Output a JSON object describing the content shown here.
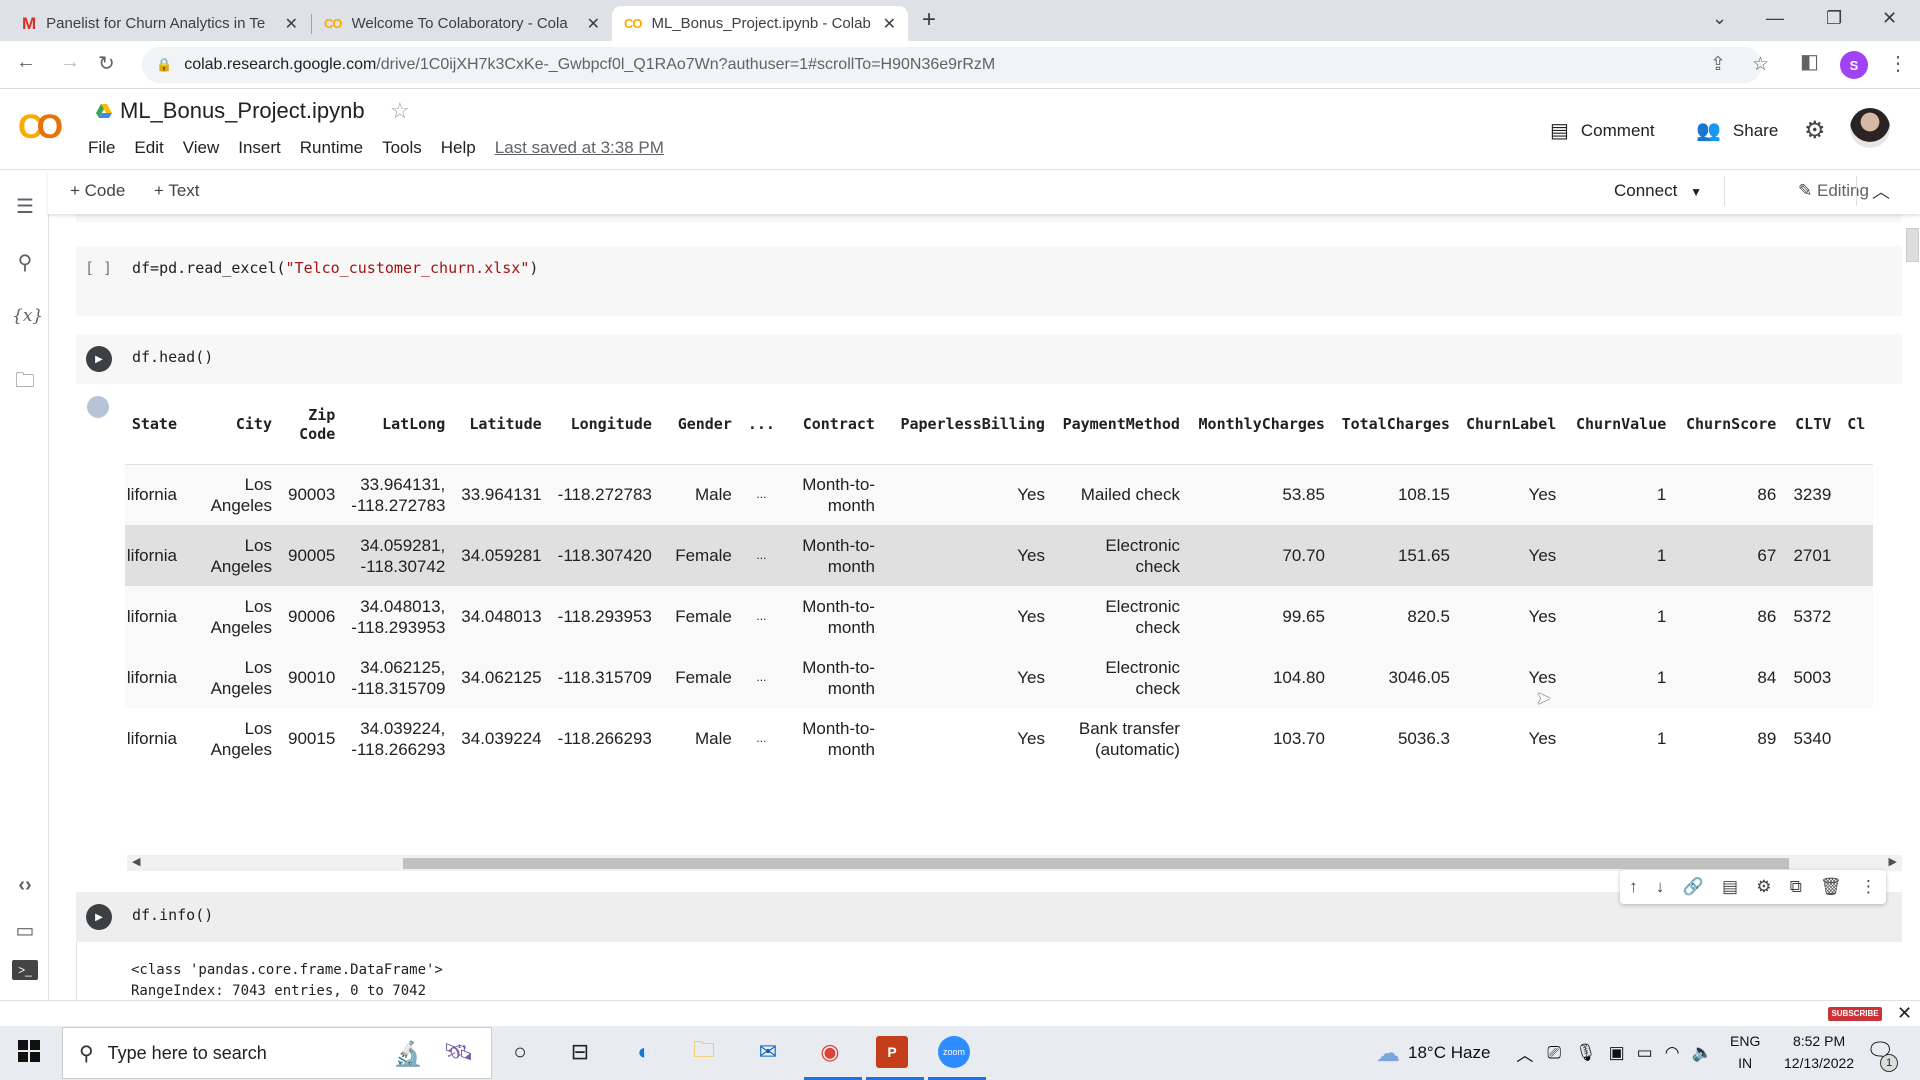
{
  "browser": {
    "tabs": [
      {
        "favicon": "gmail-icon",
        "title": "Panelist for Churn Analytics in Te",
        "active": false
      },
      {
        "favicon": "colab-icon",
        "title": "Welcome To Colaboratory - Cola",
        "active": false
      },
      {
        "favicon": "colab-icon",
        "title": "ML_Bonus_Project.ipynb - Colab",
        "active": true
      }
    ],
    "new_tab": "+",
    "url_host": "colab.research.google.com",
    "url_path": "/drive/1C0ijXH7k3CxKe-_Gwbpcf0l_Q1RAo7Wn?authuser=1#scrollTo=H90N36e9rRzM",
    "profile_initial": "S",
    "profile_color": "#a142f4"
  },
  "colab": {
    "notebook_title": "ML_Bonus_Project.ipynb",
    "menu": [
      "File",
      "Edit",
      "View",
      "Insert",
      "Runtime",
      "Tools",
      "Help"
    ],
    "last_saved": "Last saved at 3:38 PM",
    "comment_label": "Comment",
    "share_label": "Share",
    "toolbar": {
      "add_code": "+ Code",
      "add_text": "+ Text",
      "connect": "Connect",
      "editing": "Editing"
    },
    "accent": "#f9ab00"
  },
  "cells": [
    {
      "bracket": "[ ]",
      "code_prefix": "df=pd.read_excel(",
      "code_string": "\"Telco_customer_churn.xlsx\"",
      "code_suffix": ")"
    },
    {
      "code": "df.head()"
    },
    {
      "code": "df.info()",
      "output_lines": [
        "<class 'pandas.core.frame.DataFrame'>",
        "RangeIndex: 7043 entries, 0 to 7042"
      ]
    }
  ],
  "dataframe": {
    "columns": [
      "State",
      "City",
      "Zip\nCode",
      "LatLong",
      "Latitude",
      "Longitude",
      "Gender",
      "...",
      "Contract",
      "PaperlessBilling",
      "PaymentMethod",
      "MonthlyCharges",
      "TotalCharges",
      "ChurnLabel",
      "ChurnValue",
      "ChurnScore",
      "CLTV",
      "Cl"
    ],
    "rows": [
      [
        "lifornia",
        "Los Angeles",
        "90003",
        "33.964131, -118.272783",
        "33.964131",
        "-118.272783",
        "Male",
        "...",
        "Month-to- month",
        "Yes",
        "Mailed check",
        "53.85",
        "108.15",
        "Yes",
        "1",
        "86",
        "3239",
        ""
      ],
      [
        "lifornia",
        "Los Angeles",
        "90005",
        "34.059281, -118.30742",
        "34.059281",
        "-118.307420",
        "Female",
        "...",
        "Month-to- month",
        "Yes",
        "Electronic check",
        "70.70",
        "151.65",
        "Yes",
        "1",
        "67",
        "2701",
        ""
      ],
      [
        "lifornia",
        "Los Angeles",
        "90006",
        "34.048013, -118.293953",
        "34.048013",
        "-118.293953",
        "Female",
        "...",
        "Month-to- month",
        "Yes",
        "Electronic check",
        "99.65",
        "820.5",
        "Yes",
        "1",
        "86",
        "5372",
        ""
      ],
      [
        "lifornia",
        "Los Angeles",
        "90010",
        "34.062125, -118.315709",
        "34.062125",
        "-118.315709",
        "Female",
        "...",
        "Month-to- month",
        "Yes",
        "Electronic check",
        "104.80",
        "3046.05",
        "Yes",
        "1",
        "84",
        "5003",
        ""
      ],
      [
        "lifornia",
        "Los Angeles",
        "90015",
        "34.039224, -118.266293",
        "34.039224",
        "-118.266293",
        "Male",
        "...",
        "Month-to- month",
        "Yes",
        "Bank transfer (automatic)",
        "103.70",
        "5036.3",
        "Yes",
        "1",
        "89",
        "5340",
        ""
      ]
    ]
  },
  "overlay": {
    "subscribe": "SUBSCRIBE"
  },
  "taskbar": {
    "search_placeholder": "Type here to search",
    "weather": "18°C  Haze",
    "lang_top": "ENG",
    "lang_bottom": "IN",
    "time": "8:52 PM",
    "date": "12/13/2022",
    "notification_count": "1"
  }
}
